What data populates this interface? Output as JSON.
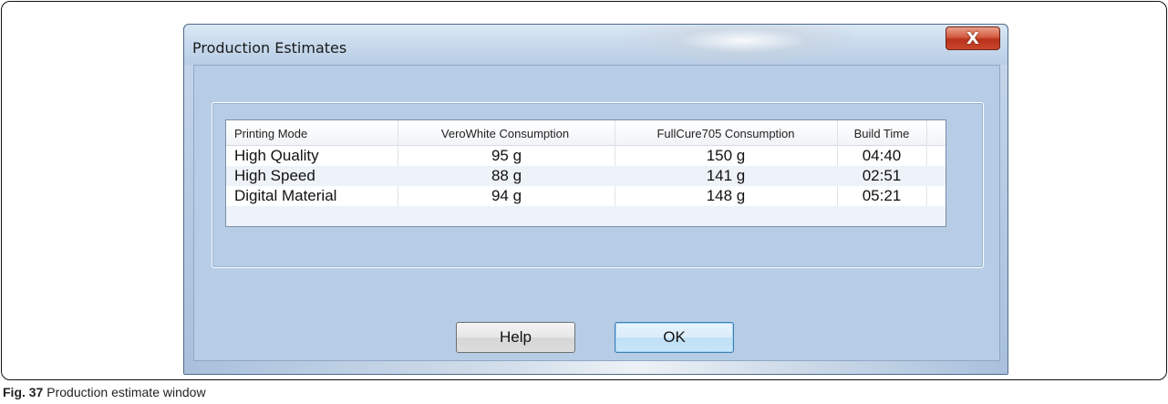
{
  "window": {
    "title": "Production Estimates",
    "close_label": "X"
  },
  "table": {
    "headers": [
      "Printing Mode",
      "VeroWhite Consumption",
      "FullCure705 Consumption",
      "Build Time"
    ],
    "rows": [
      [
        "High Quality",
        "95 g",
        "150 g",
        "04:40"
      ],
      [
        "High Speed",
        "88 g",
        "141 g",
        "02:51"
      ],
      [
        "Digital Material",
        "94 g",
        "148 g",
        "05:21"
      ]
    ]
  },
  "buttons": {
    "help_label": "Help",
    "ok_label": "OK"
  },
  "caption": {
    "label": "Fig. 37",
    "text": "Production estimate window"
  }
}
